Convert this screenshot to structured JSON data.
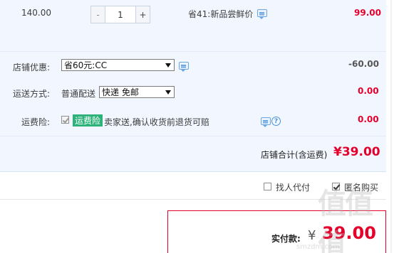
{
  "item": {
    "unit_price": "140.00",
    "minus_label": "-",
    "quantity": "1",
    "plus_label": "+",
    "promotion": "省41:新品尝鲜价",
    "subtotal": "99.00"
  },
  "shop_discount": {
    "label": "店铺优惠:",
    "selected": "省60元:CC",
    "amount": "-60.00"
  },
  "shipping": {
    "label": "运送方式:",
    "method": "普通配送",
    "selected": "快递 免邮",
    "amount": "0.00"
  },
  "freight_insurance": {
    "label": "运费险:",
    "tag": "运费险",
    "description": "卖家送,确认收货前退货可赔",
    "help_symbol": "?",
    "amount": "0.00"
  },
  "shop_total": {
    "label": "店铺合计(含运费)",
    "value": "¥39.00"
  },
  "options": {
    "proxy_pay_label": "找人代付",
    "proxy_pay_checked": false,
    "anonymous_label": "匿名购买",
    "anonymous_checked": true
  },
  "payment": {
    "label": "实付款:",
    "currency": "¥",
    "value": "39.00"
  },
  "watermark": {
    "text": "值值值",
    "subtext": "smzdm.com"
  },
  "colors": {
    "accent_red": "#e4002b",
    "panel_blue": "#f2f7ff",
    "tag_green": "#2db27a"
  }
}
